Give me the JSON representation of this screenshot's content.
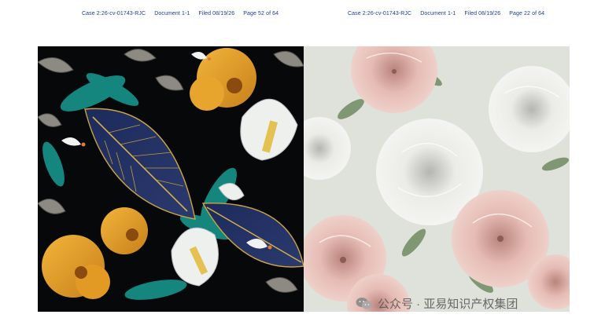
{
  "left_header": {
    "case": "Case 2:26-cv-01743-RJC",
    "document": "Document 1-1",
    "filed": "Filed 08/19/26",
    "page": "Page 52 of 64"
  },
  "right_header": {
    "case": "Case 2:26-cv-01743-RJC",
    "document": "Document 1-1",
    "filed": "Filed 08/19/26",
    "page": "Page 22 of 64"
  },
  "watermark": {
    "text": "公众号 · 亚易知识产权集团",
    "logo_icon": "wechat-icon"
  },
  "colors": {
    "header_text": "#1f3d8c",
    "left_background": "#07080a",
    "right_background": "#dfe2da"
  }
}
